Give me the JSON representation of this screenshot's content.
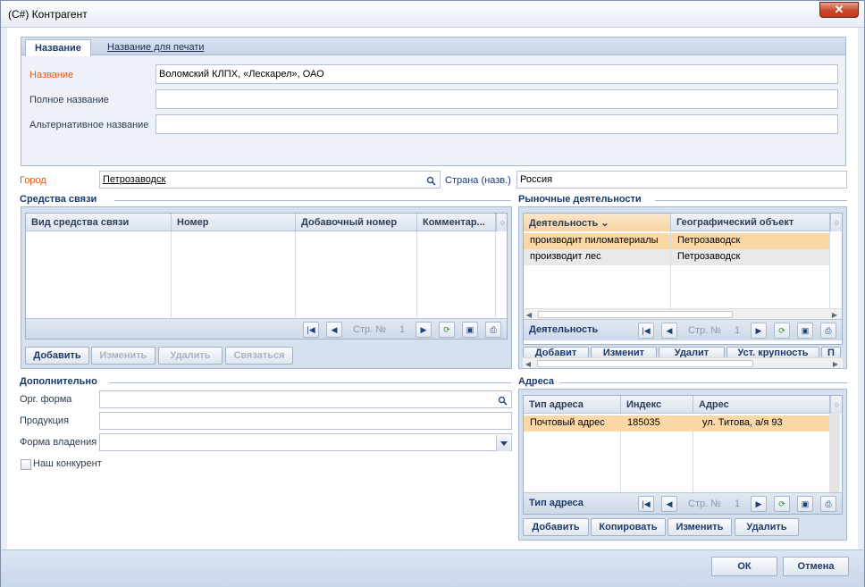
{
  "window": {
    "title": "(C#) Контрагент",
    "close_glyph": "✕"
  },
  "tabs": [
    {
      "label": "Название"
    },
    {
      "label": "Название для печати"
    }
  ],
  "names": {
    "name_label": "Название",
    "name_value": "Воломский КЛПХ, «Лескарел», ОАО",
    "fullname_label": "Полное название",
    "fullname_value": "",
    "altname_label": "Альтернативное название",
    "altname_value": ""
  },
  "city": {
    "label": "Город",
    "value": "Петрозаводск"
  },
  "country": {
    "label": "Страна (назв.)",
    "value": "Россия"
  },
  "contacts": {
    "title": "Средства связи",
    "columns": [
      "Вид средства связи",
      "Номер",
      "Добавочный номер",
      "Комментар..."
    ],
    "page_label": "Стр. №",
    "page_num": "1",
    "buttons": {
      "add": "Добавить",
      "edit": "Изменить",
      "delete": "Удалить",
      "connect": "Связаться"
    }
  },
  "market": {
    "title": "Рыночные деятельности",
    "columns": [
      "Деятельность",
      "Географический объект"
    ],
    "rows": [
      {
        "activity": "производит пиломатериалы",
        "geo": "Петрозаводск"
      },
      {
        "activity": "производит лес",
        "geo": "Петрозаводск"
      }
    ],
    "footer_label": "Деятельность",
    "page_label": "Стр. №",
    "page_num": "1",
    "buttons": {
      "add": "Добавит",
      "edit": "Изменит",
      "delete": "Удалит",
      "set_quality": "Уст. крупность",
      "more": "П"
    }
  },
  "additional": {
    "title": "Дополнительно",
    "org_form_label": "Орг. форма",
    "products_label": "Продукция",
    "ownership_label": "Форма владения",
    "competitor_label": "Наш конкурент"
  },
  "addresses": {
    "title": "Адреса",
    "columns": [
      "Тип адреса",
      "Индекс",
      "Адрес"
    ],
    "rows": [
      {
        "type": "Почтовый адрес",
        "index": "185035",
        "address": "ул. Титова, а/я 93"
      }
    ],
    "footer_label": "Тип адреса",
    "page_label": "Стр. №",
    "page_num": "1",
    "buttons": {
      "add": "Добавить",
      "copy": "Копировать",
      "edit": "Изменить",
      "delete": "Удалить"
    }
  },
  "dialog_buttons": {
    "ok": "ОК",
    "cancel": "Отмена"
  },
  "colors": {
    "accent": "#1b3a6b",
    "required": "#e05a1d",
    "selection": "#fbd8a6",
    "close": "#c9462a"
  }
}
